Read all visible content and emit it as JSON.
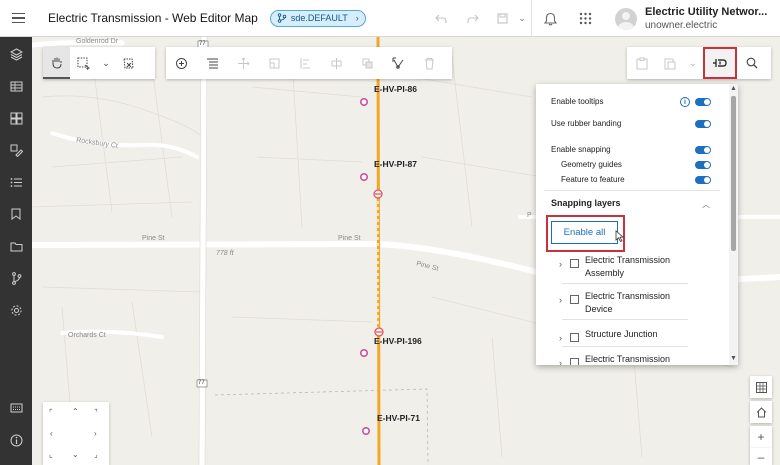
{
  "header": {
    "app_title": "Electric Transmission - Web Editor Map",
    "version_label": "sde.DEFAULT",
    "user_name": "Electric Utility Networ...",
    "user_sub": "unowner.electric"
  },
  "map": {
    "roads": {
      "goldenrod": "Goldenrod Dr",
      "rocksbury": "Rocksbury Ct",
      "pine_left": "Pine St",
      "pine_center": "Pine St",
      "pine_right": "Pine St",
      "orchards": "Orchards Ct",
      "elevation": "778 ft",
      "p_edge": "P",
      "route_77": "77"
    },
    "assets": {
      "a86": "E-HV-PI-86",
      "a87": "E-HV-PI-87",
      "a196": "E-HV-PI-196",
      "a71": "E-HV-PI-71"
    }
  },
  "settings_panel": {
    "enable_tooltips": "Enable tooltips",
    "use_rubber_banding": "Use rubber banding",
    "enable_snapping": "Enable snapping",
    "geometry_guides": "Geometry guides",
    "feature_to_feature": "Feature to feature",
    "snapping_layers_title": "Snapping layers",
    "enable_all_label": "Enable all",
    "layers": [
      {
        "line1": "Electric Transmission",
        "line2": "Assembly"
      },
      {
        "line1": "Electric Transmission",
        "line2": "Device"
      },
      {
        "line1": "Structure Junction",
        "line2": ""
      },
      {
        "line1": "Electric Transmission",
        "line2": ""
      }
    ]
  },
  "colors": {
    "accent": "#1d6fbf",
    "highlight": "#c9323c",
    "line": "#f5a623",
    "sidebar": "#333333"
  }
}
